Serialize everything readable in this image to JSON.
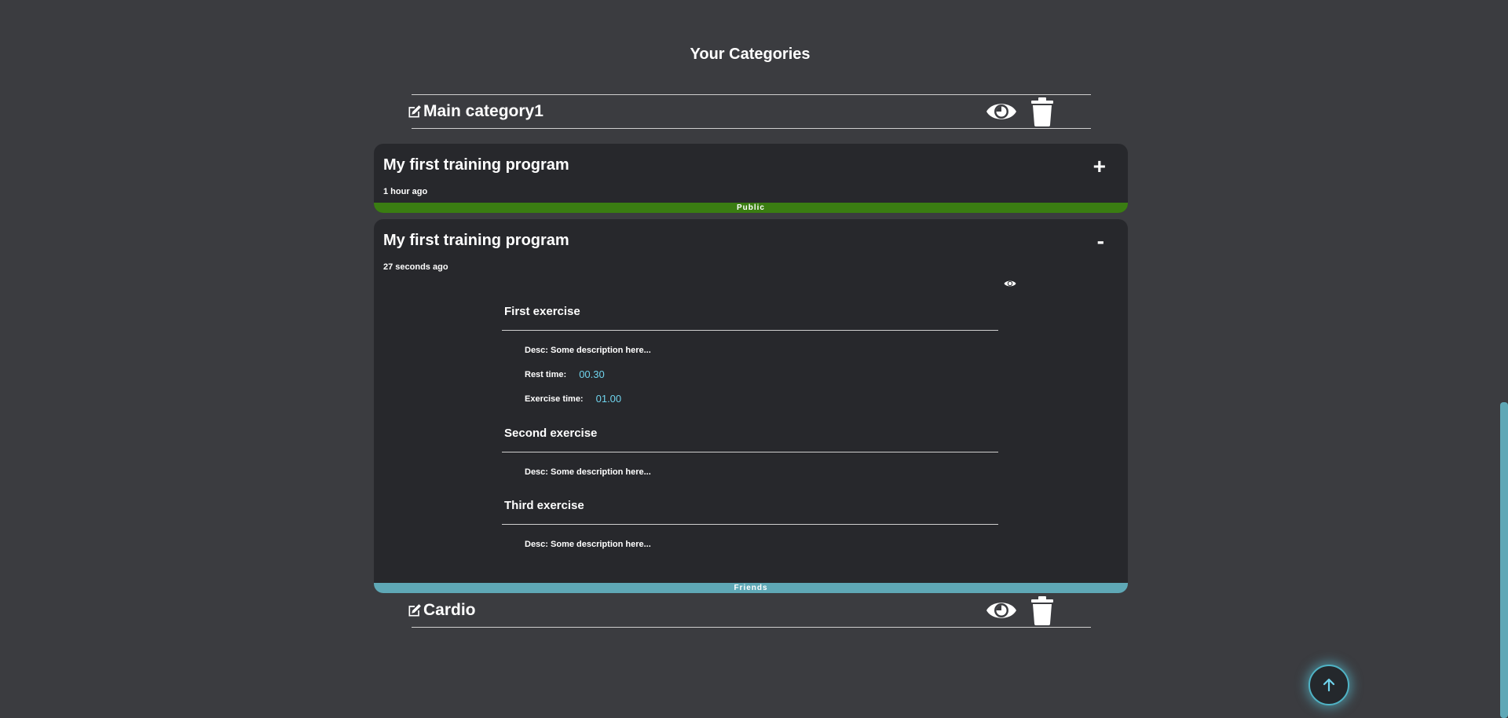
{
  "page": {
    "title": "Your Categories"
  },
  "categories": [
    {
      "name": "Main category1"
    },
    {
      "name": "Cardio"
    }
  ],
  "programs": [
    {
      "title": "My first training program",
      "time": "1 hour ago",
      "toggle": "+",
      "visibility": "Public"
    },
    {
      "title": "My first training program",
      "time": "27 seconds ago",
      "toggle": "-",
      "visibility": "Friends",
      "exercises": [
        {
          "name": "First exercise",
          "desc": "Desc: Some description here...",
          "rest_label": "Rest time:",
          "rest_value": "00.30",
          "exercise_label": "Exercise time:",
          "exercise_value": "01.00"
        },
        {
          "name": "Second exercise",
          "desc": "Desc: Some description here..."
        },
        {
          "name": "Third exercise",
          "desc": "Desc: Some description here..."
        }
      ]
    }
  ],
  "colors": {
    "background": "#3b3c40",
    "card": "#27282c",
    "public": "#3a7d12",
    "friends": "#5fa8b6",
    "accent_value": "#6fd3ec"
  },
  "icons": {
    "edit": "edit-icon",
    "view": "eye-icon",
    "delete": "trash-icon",
    "scroll_top": "arrow-up-icon"
  }
}
